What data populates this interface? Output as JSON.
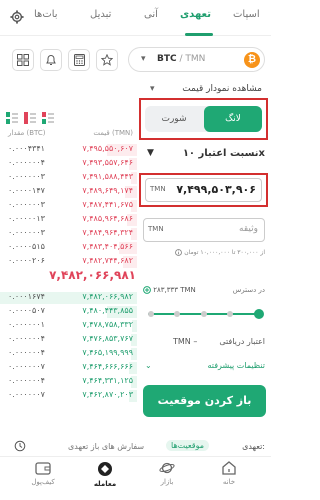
{
  "tabs": [
    {
      "label": "اسپات",
      "active": false
    },
    {
      "label": "تعهدی",
      "active": true
    },
    {
      "label": "آنی",
      "active": false
    },
    {
      "label": "تبدیل",
      "active": false
    },
    {
      "label": "بات‌ها",
      "active": false
    }
  ],
  "pair": {
    "base": "BTC",
    "quote": "TMN",
    "separator": " / "
  },
  "chart_link": "مشاهده نمودار قیمت",
  "orderbook": {
    "qty_header": "مقدار (BTC)",
    "price_header": "قیمت (TMN)",
    "sells": [
      {
        "price": "۷,۴۹۵,۵۵۰,۶۰۷",
        "qty": "۰.۰۰۰۴۳۴۱"
      },
      {
        "price": "۷,۴۹۳,۵۵۷,۶۴۶",
        "qty": "۰.۰۰۰۰۰۰۴"
      },
      {
        "price": "۷,۴۹۱,۵۸۸,۴۴۳",
        "qty": "۰.۰۰۰۰۰۰۳"
      },
      {
        "price": "۷,۴۸۹,۶۴۹,۱۷۴",
        "qty": "۰.۰۰۰۰۱۴۷"
      },
      {
        "price": "۷,۴۸۷,۴۴۱,۶۷۵",
        "qty": "۰.۰۰۰۰۰۰۳"
      },
      {
        "price": "۷,۴۸۵,۹۶۴,۶۸۶",
        "qty": "۰.۰۰۰۰۰۱۳"
      },
      {
        "price": "۷,۴۸۴,۹۶۴,۳۲۴",
        "qty": "۰.۰۰۰۰۰۰۳"
      },
      {
        "price": "۷,۴۸۳,۴۰۴,۵۶۶",
        "qty": "۰.۰۰۰۰۵۱۵"
      },
      {
        "price": "۷,۴۸۲,۷۴۴,۶۸۲",
        "qty": "۰.۰۰۰۰۲۰۶"
      }
    ],
    "last_price": "۷,۴۸۲,۰۶۶,۹۸۱",
    "buys": [
      {
        "price": "۷,۴۸۲,۰۶۶,۹۸۲",
        "qty": "۰.۰۰۰۱۶۷۴"
      },
      {
        "price": "۷,۴۸۰,۴۴۳,۸۵۵",
        "qty": "۰.۰۰۰۰۵۰۷"
      },
      {
        "price": "۷,۴۷۸,۷۵۸,۳۳۲",
        "qty": "۰.۰۰۰۰۰۰۱"
      },
      {
        "price": "۷,۴۷۶,۸۵۳,۷۶۷",
        "qty": "۰.۰۰۰۰۰۰۴"
      },
      {
        "price": "۷,۴۶۵,۱۹۹,۹۹۹",
        "qty": "۰.۰۰۰۰۰۰۴"
      },
      {
        "price": "۷,۴۶۴,۶۶۶,۶۶۶",
        "qty": "۰.۰۰۰۰۰۰۷"
      },
      {
        "price": "۷,۴۶۴,۳۳۱,۱۲۵",
        "qty": "۰.۰۰۰۰۰۰۴"
      },
      {
        "price": "۷,۴۶۲,۸۷۰,۲۰۳",
        "qty": "۰.۰۰۰۰۰۰۷"
      }
    ]
  },
  "form": {
    "long_label": "لانگ",
    "short_label": "شورت",
    "leverage_label": "نسبت اعتبار ۱۰x",
    "price_unit": "TMN",
    "price_value": "۷,۴۹۹,۵۰۳,۹۰۶",
    "collateral_unit": "TMN",
    "collateral_placeholder": "وثیقه",
    "collateral_hint": "از ۳۰۰,۰۰۰ تا ۱۰,۰۰۰,۰۰۰ تومان",
    "available_label": "در دسترس",
    "available_value": "۲۸۳,۳۳۳ TMN",
    "receive_label": "اعتبار دریافتی",
    "receive_value": "TMN –",
    "advanced_label": "تنظیمات پیشرفته",
    "open_button": "باز کردن موقعیت",
    "slider_percent": 100
  },
  "sub_tabs": {
    "mine_label": "تعهدی:",
    "positions_label": "موقعیت‌ها",
    "orders_label": "سفارش های باز تعهدی"
  },
  "bottom_nav": [
    {
      "label": "خانه",
      "icon": "home-icon",
      "active": false
    },
    {
      "label": "بازار",
      "icon": "planet-icon",
      "active": false
    },
    {
      "label": "معامله",
      "icon": "trade-icon",
      "active": true
    },
    {
      "label": "کیف‌پول",
      "icon": "wallet-icon",
      "active": false
    }
  ],
  "colors": {
    "accent": "#1fa874",
    "sell": "#e0445a",
    "buy": "#1f9e6e",
    "highlight": "#d32f2f"
  }
}
